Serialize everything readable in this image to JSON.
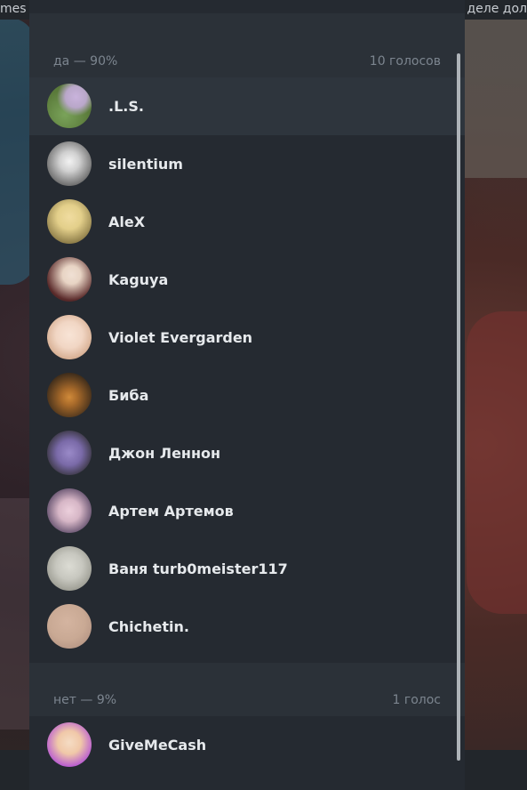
{
  "background": {
    "top_left_text": "mes",
    "top_right_text": "деле дол"
  },
  "poll": {
    "sections": [
      {
        "option_label": "да — 90%",
        "vote_count": "10 голосов",
        "voters": [
          {
            "name": ".L.S.",
            "avatar_colors": [
              "#7aa35a",
              "#b9a7c9"
            ]
          },
          {
            "name": "silentium",
            "avatar_colors": [
              "#c9c9c9",
              "#6a6a6a"
            ]
          },
          {
            "name": "AleX",
            "avatar_colors": [
              "#e3cf8a",
              "#7a6a3a"
            ]
          },
          {
            "name": "Kaguya",
            "avatar_colors": [
              "#e8d4c4",
              "#5a2a2a"
            ]
          },
          {
            "name": "Violet Evergarden",
            "avatar_colors": [
              "#f1d6c4",
              "#c99b7a"
            ]
          },
          {
            "name": "Биба",
            "avatar_colors": [
              "#a86a2a",
              "#3a2a1a"
            ]
          },
          {
            "name": "Джон Леннон",
            "avatar_colors": [
              "#7a6aa8",
              "#2a2a2a"
            ]
          },
          {
            "name": "Артем Артемов",
            "avatar_colors": [
              "#d6b6c6",
              "#4a3a5a"
            ]
          },
          {
            "name": "Ваня turb0meister117",
            "avatar_colors": [
              "#c7c7bf",
              "#8a8a80"
            ]
          },
          {
            "name": "Chichetin.",
            "avatar_colors": [
              "#c9a994",
              "#a8887a"
            ]
          }
        ]
      },
      {
        "option_label": "нет — 9%",
        "vote_count": "1 голос",
        "voters": [
          {
            "name": "GiveMeCash",
            "avatar_colors": [
              "#f0c8a8",
              "#b04ad8"
            ]
          }
        ]
      }
    ]
  }
}
